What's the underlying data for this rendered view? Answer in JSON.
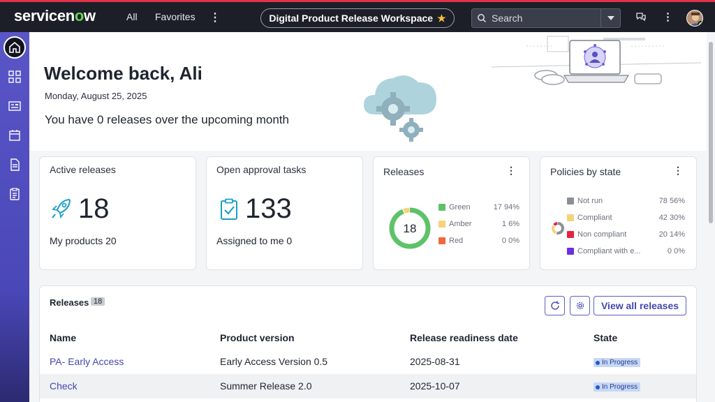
{
  "topnav": {
    "logo_text_a": "servicen",
    "logo_text_o": "o",
    "logo_text_b": "w",
    "all_label": "All",
    "favorites_label": "Favorites",
    "more_icon": "vertical-ellipsis-icon",
    "workspace_title": "Digital Product Release Workspace",
    "workspace_star": "★",
    "search_placeholder": "Search",
    "chat_icon": "chat-icon",
    "settings_icon": "vertical-ellipsis-icon",
    "accent_color": "#e0324a"
  },
  "rail": {
    "items": [
      "home-icon",
      "grid-icon",
      "list-card-icon",
      "calendar-icon",
      "document-icon",
      "clipboard-icon"
    ]
  },
  "hero": {
    "welcome": "Welcome back, Ali",
    "date": "Monday, August 25, 2025",
    "message": "You have 0 releases over the upcoming month"
  },
  "cards": {
    "active": {
      "title": "Active releases",
      "value": "18",
      "sub": "My products 20"
    },
    "approvals": {
      "title": "Open approval tasks",
      "value": "133",
      "sub": "Assigned to me 0"
    },
    "releases": {
      "title": "Releases",
      "total": "18",
      "legend": [
        {
          "label": "Green",
          "value": "17 94%",
          "color": "#5ec26a",
          "count": 17
        },
        {
          "label": "Amber",
          "value": "1 6%",
          "color": "#f6d37a",
          "count": 1
        },
        {
          "label": "Red",
          "value": "0 0%",
          "color": "#f2683a",
          "count": 0
        }
      ]
    },
    "policies": {
      "title": "Policies by state",
      "legend": [
        {
          "label": "Not run",
          "value": "78 56%",
          "color": "#8d8f97",
          "count": 78
        },
        {
          "label": "Compliant",
          "value": "42 30%",
          "color": "#f4d27a",
          "count": 42
        },
        {
          "label": "Non compliant",
          "value": "20 14%",
          "color": "#e8213f",
          "count": 20
        },
        {
          "label": "Compliant with e...",
          "value": "0 0%",
          "color": "#6a2fe0",
          "count": 0
        }
      ]
    }
  },
  "table": {
    "title": "Releases",
    "count": "18",
    "view_all_label": "View all releases",
    "columns": [
      "Name",
      "Product version",
      "Release readiness date",
      "State"
    ],
    "rows": [
      {
        "name": "PA- Early Access",
        "version": "Early Access Version 0.5",
        "date": "2025-08-31",
        "state": "In Progress"
      },
      {
        "name": "Check",
        "version": "Summer Release 2.0",
        "date": "2025-10-07",
        "state": "In Progress"
      }
    ]
  }
}
